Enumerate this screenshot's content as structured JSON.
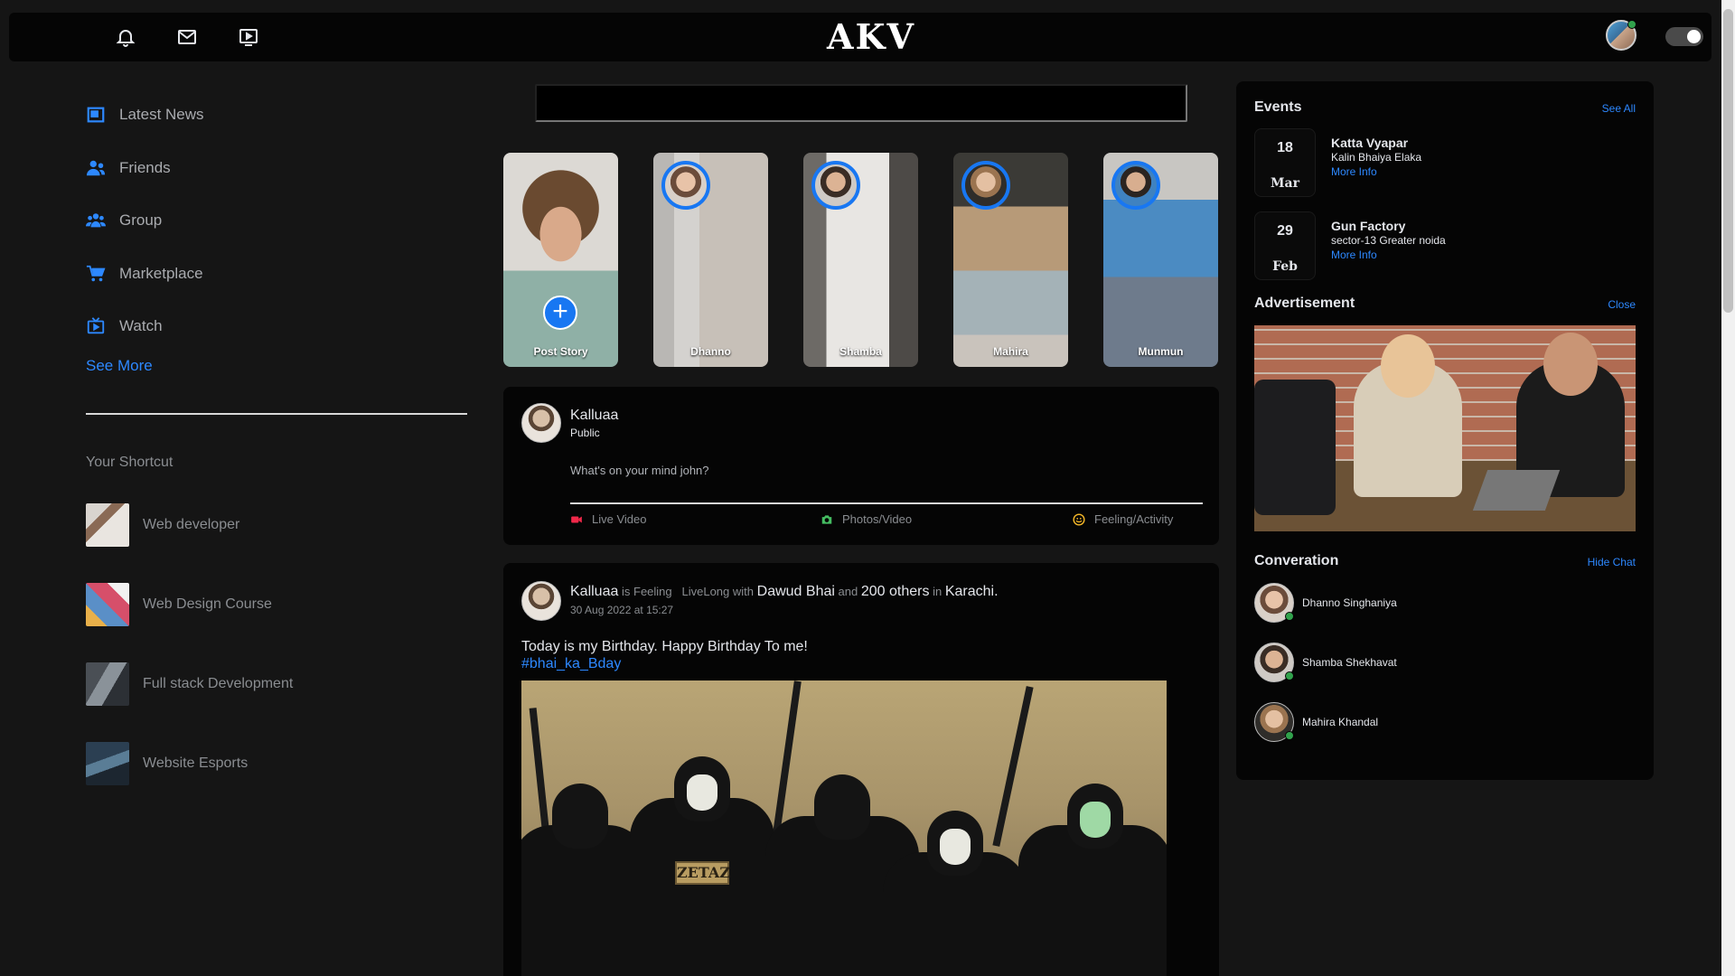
{
  "topnav": {
    "logo": "AKV",
    "icons": [
      "bell-icon",
      "mail-icon",
      "tv-icon"
    ]
  },
  "sidebar": {
    "items": [
      {
        "label": "Latest News",
        "icon": "news-icon"
      },
      {
        "label": "Friends",
        "icon": "friends-icon"
      },
      {
        "label": "Group",
        "icon": "group-icon"
      },
      {
        "label": "Marketplace",
        "icon": "cart-icon"
      },
      {
        "label": "Watch",
        "icon": "watch-icon"
      }
    ],
    "see_more": "See More",
    "shortcut_title": "Your Shortcut",
    "shortcuts": [
      {
        "label": "Web developer"
      },
      {
        "label": "Web Design Course"
      },
      {
        "label": "Full stack Development"
      },
      {
        "label": "Website Esports"
      }
    ]
  },
  "search": {
    "placeholder": ""
  },
  "stories": [
    {
      "name": "Post Story"
    },
    {
      "name": "Dhanno"
    },
    {
      "name": "Shamba"
    },
    {
      "name": "Mahira"
    },
    {
      "name": "Munmun"
    }
  ],
  "composer": {
    "name": "Kalluaa",
    "audience": "Public",
    "placeholder": "What's on your mind john?",
    "actions": [
      {
        "label": "Live Video",
        "icon": "video-icon",
        "color": "#f02849"
      },
      {
        "label": "Photos/Video",
        "icon": "camera-icon",
        "color": "#45bd62"
      },
      {
        "label": "Feeling/Activity",
        "icon": "smile-icon",
        "color": "#f7b928"
      }
    ]
  },
  "post": {
    "author": "Kalluaa",
    "is_feeling": "is Feeling",
    "feeling": "LiveLong",
    "with": "with",
    "friend": "Dawud Bhai",
    "and": "and",
    "others": "200 others",
    "in": "in",
    "place": "Karachi.",
    "time": "30 Aug 2022 at 15:27",
    "text": "Today is my Birthday. Happy Birthday To me!",
    "hashtag": "#bhai_ka_Bday",
    "patch_text": "ZETAZ"
  },
  "events": {
    "title": "Events",
    "see_all": "See All",
    "items": [
      {
        "day": "18",
        "month": "Mar",
        "title": "Katta Vyapar",
        "sub": "Kalin Bhaiya Elaka",
        "more": "More Info"
      },
      {
        "day": "29",
        "month": "Feb",
        "title": "Gun Factory",
        "sub": "sector-13 Greater noida",
        "more": "More Info"
      }
    ]
  },
  "advertisement": {
    "title": "Advertisement",
    "close": "Close"
  },
  "conversation": {
    "title": "Converation",
    "hide": "Hide Chat",
    "contacts": [
      {
        "name": "Dhanno Singhaniya"
      },
      {
        "name": "Shamba Shekhavat"
      },
      {
        "name": "Mahira Khandal"
      }
    ]
  },
  "colors": {
    "accent": "#2d88ff",
    "story_ring": "#1877f2",
    "online": "#31a24c"
  }
}
